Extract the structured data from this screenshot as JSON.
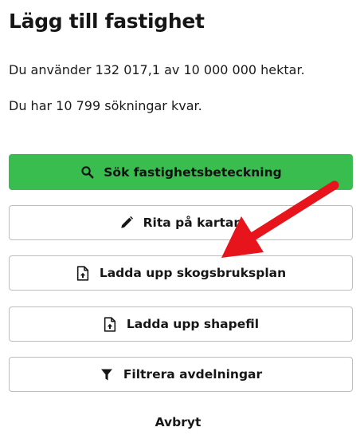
{
  "page": {
    "title": "Lägg till fastighet",
    "usage_text": "Du använder 132 017,1 av 10 000 000 hektar.",
    "searches_text": "Du har 10 799 sökningar kvar."
  },
  "actions": {
    "search_label": "Sök fastighetsbeteckning",
    "draw_label": "Rita på kartan",
    "upload_plan_label": "Ladda upp skogsbruksplan",
    "upload_shape_label": "Ladda upp shapefil",
    "filter_label": "Filtrera avdelningar",
    "cancel_label": "Avbryt"
  },
  "icons": {
    "search": "search-icon",
    "draw": "pencil-icon",
    "upload_plan": "file-upload-icon",
    "upload_shape": "file-upload-icon",
    "filter": "filter-icon",
    "annotation": "red-arrow"
  },
  "colors": {
    "primary_button": "#39bd4e",
    "annotation_arrow": "#e8141c",
    "button_border": "#bdbdbd"
  }
}
